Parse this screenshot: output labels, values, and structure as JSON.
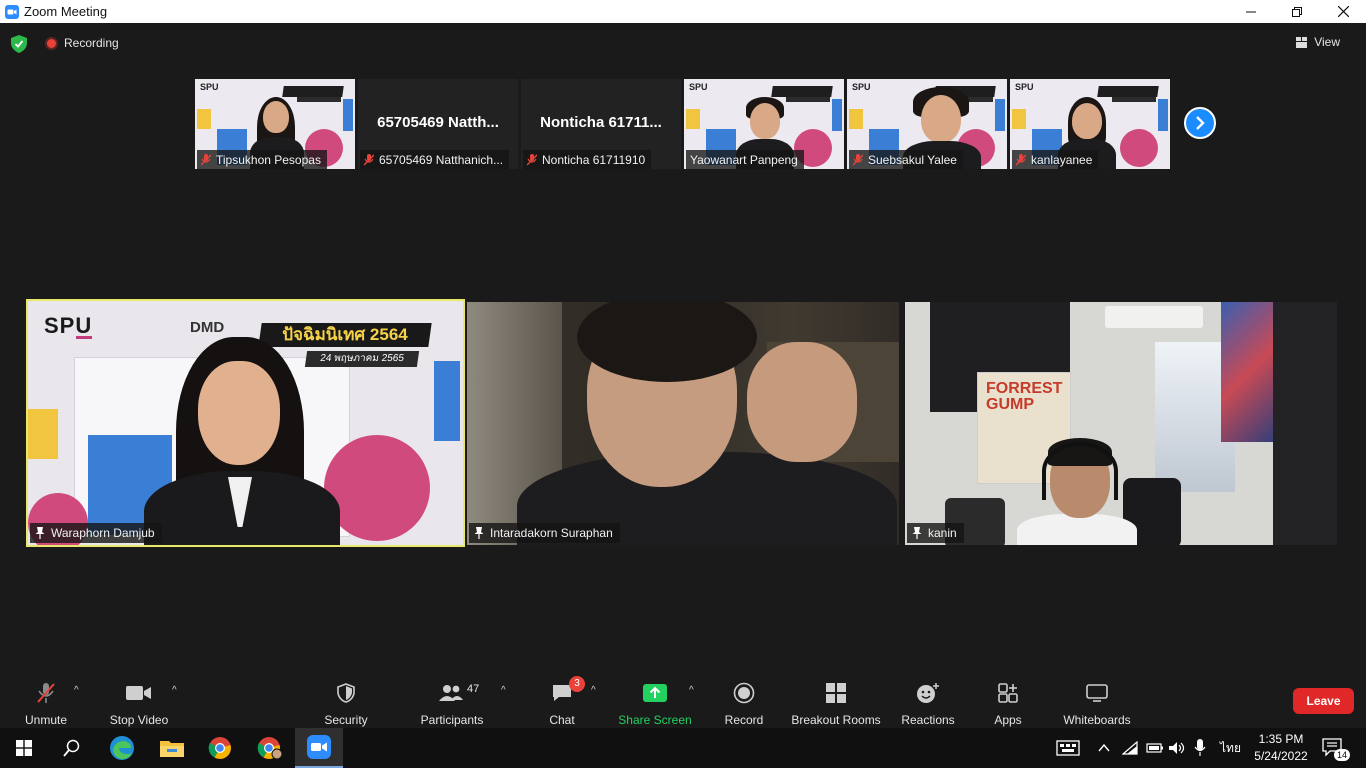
{
  "window": {
    "title": "Zoom Meeting"
  },
  "top_bar": {
    "recording_label": "Recording",
    "view_label": "View"
  },
  "thumbnails": [
    {
      "name": "Tipsukhon Pesopas",
      "video": true
    },
    {
      "name": "65705469 Natthanich...",
      "display_name": "65705469 Natth...",
      "video": false
    },
    {
      "name": "Nonticha 61711910",
      "display_name": "Nonticha 61711...",
      "video": false
    },
    {
      "name": "Yaowanart Panpeng",
      "video": true
    },
    {
      "name": "Suebsakul Yalee",
      "video": true
    },
    {
      "name": "kanlayanee",
      "video": true
    }
  ],
  "main_tiles": [
    {
      "name": "Waraphorn Damjub",
      "active_speaker": true
    },
    {
      "name": "Intaradakorn Suraphan",
      "active_speaker": false
    },
    {
      "name": "kanin",
      "active_speaker": false
    }
  ],
  "poster": {
    "logo": "SPU",
    "dmd": "DMD",
    "title": "ปัจฉิมนิเทศ 2564",
    "date": "24 พฤษภาคม 2565"
  },
  "scene3": {
    "poster_text": "FORREST GUMP"
  },
  "toolbar": {
    "unmute": "Unmute",
    "stop_video": "Stop Video",
    "security": "Security",
    "participants": "Participants",
    "participants_count": "47",
    "chat": "Chat",
    "chat_badge": "3",
    "share_screen": "Share Screen",
    "record": "Record",
    "breakout_rooms": "Breakout Rooms",
    "reactions": "Reactions",
    "apps": "Apps",
    "whiteboards": "Whiteboards",
    "leave": "Leave"
  },
  "taskbar": {
    "time": "1:35 PM",
    "date": "5/24/2022",
    "language": "ไทย",
    "notifications_count": "14"
  },
  "colors": {
    "zoom_blue": "#1a8cff",
    "share_green": "#23d160",
    "leave_red": "#e02828",
    "active_speaker_border": "#e8e86a",
    "background": "#1a1a1a"
  }
}
